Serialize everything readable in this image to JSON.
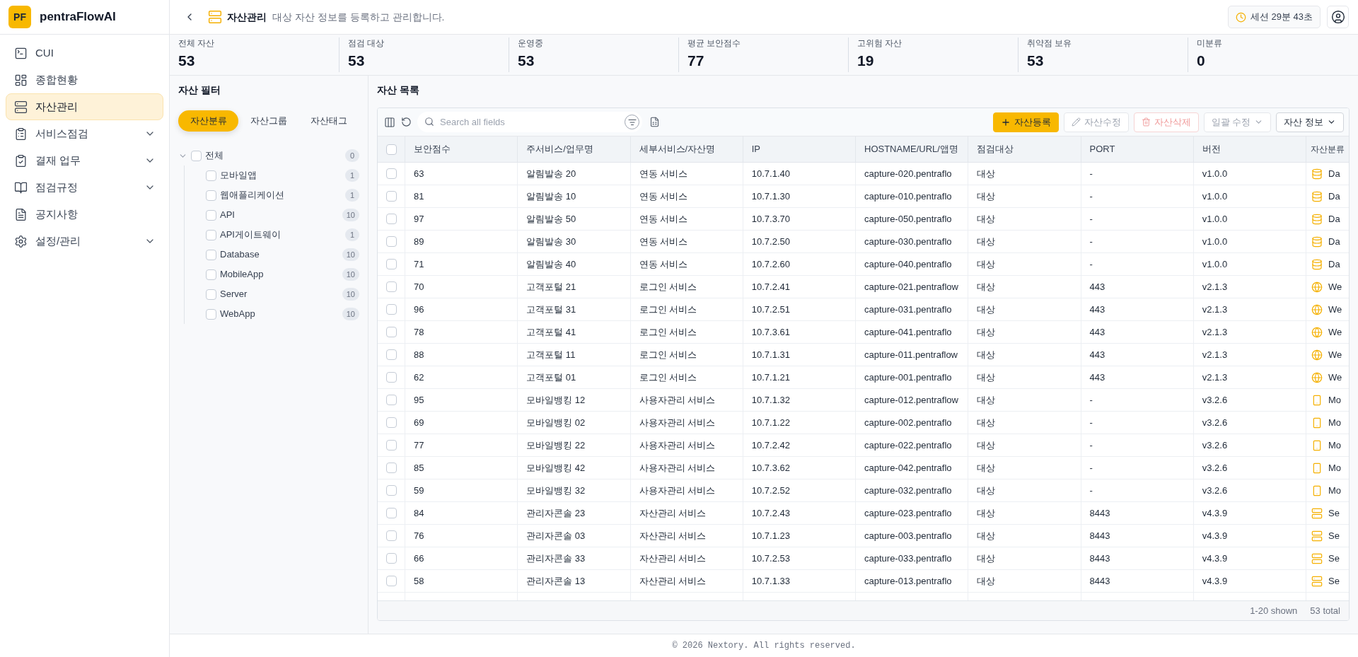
{
  "app": {
    "logo": "PF",
    "name": "pentraFlowAI"
  },
  "sidebar": {
    "items": [
      {
        "label": "CUI",
        "kind": "link",
        "selected": false
      },
      {
        "label": "종합현황",
        "kind": "link",
        "selected": false
      },
      {
        "label": "자산관리",
        "kind": "link",
        "selected": true
      },
      {
        "label": "서비스점검",
        "kind": "group",
        "selected": false,
        "expanded": false
      },
      {
        "label": "결재 업무",
        "kind": "group",
        "selected": false,
        "expanded": false
      },
      {
        "label": "점검규정",
        "kind": "group",
        "selected": false,
        "expanded": false
      },
      {
        "label": "공지사항",
        "kind": "link",
        "selected": false
      },
      {
        "label": "설정/관리",
        "kind": "group",
        "selected": false,
        "expanded": false
      }
    ]
  },
  "header": {
    "title": "자산관리",
    "description": "대상 자산 정보를 등록하고 관리합니다.",
    "session": "세션 29분 43초"
  },
  "stats": [
    {
      "label": "전체 자산",
      "value": "53"
    },
    {
      "label": "점검 대상",
      "value": "53"
    },
    {
      "label": "운영중",
      "value": "53"
    },
    {
      "label": "평균 보안점수",
      "value": "77"
    },
    {
      "label": "고위험 자산",
      "value": "19"
    },
    {
      "label": "취약점 보유",
      "value": "53"
    },
    {
      "label": "미분류",
      "value": "0"
    }
  ],
  "filter": {
    "title": "자산 필터",
    "tabs": [
      {
        "label": "자산분류",
        "selected": true
      },
      {
        "label": "자산그룹",
        "selected": false
      },
      {
        "label": "자산태그",
        "selected": false
      }
    ],
    "tree": [
      {
        "label": "전체",
        "count": "0",
        "checked": false,
        "expanded": true,
        "children": [
          {
            "label": "모바일앱",
            "count": "1",
            "checked": false
          },
          {
            "label": "웹애플리케이션",
            "count": "1",
            "checked": false
          },
          {
            "label": "API",
            "count": "10",
            "checked": false
          },
          {
            "label": "API게이트웨이",
            "count": "1",
            "checked": false
          },
          {
            "label": "Database",
            "count": "10",
            "checked": false
          },
          {
            "label": "MobileApp",
            "count": "10",
            "checked": false
          },
          {
            "label": "Server",
            "count": "10",
            "checked": false
          },
          {
            "label": "WebApp",
            "count": "10",
            "checked": false
          }
        ]
      }
    ]
  },
  "assets": {
    "title": "자산 목록",
    "search": {
      "placeholder": "Search all fields"
    },
    "buttons": [
      {
        "label": "자산등록",
        "kind": "primary",
        "disabled": false
      },
      {
        "label": "자산수정",
        "kind": "edit",
        "disabled": true
      },
      {
        "label": "자산삭제",
        "kind": "delete",
        "disabled": true
      },
      {
        "label": "일괄 수정",
        "kind": "dropdown",
        "disabled": true
      },
      {
        "label": "자산 정보",
        "kind": "dropdown",
        "disabled": false
      }
    ],
    "table": {
      "select_all": {
        "checked": false
      },
      "columns": [
        "보안점수",
        "주서비스/업무명",
        "세부서비스/자산명",
        "IP",
        "HOSTNAME/URL/앱명",
        "점검대상",
        "PORT",
        "버전",
        "자산분류"
      ],
      "rows": [
        {
          "checked": false,
          "cells": [
            "63",
            "알림발송 20",
            "연동 서비스",
            "10.7.1.40",
            "capture-020.pentraflo",
            "대상",
            "-",
            "v1.0.0"
          ],
          "category": {
            "kind": "database",
            "label": "Da"
          }
        },
        {
          "checked": false,
          "cells": [
            "81",
            "알림발송 10",
            "연동 서비스",
            "10.7.1.30",
            "capture-010.pentraflo",
            "대상",
            "-",
            "v1.0.0"
          ],
          "category": {
            "kind": "database",
            "label": "Da"
          }
        },
        {
          "checked": false,
          "cells": [
            "97",
            "알림발송 50",
            "연동 서비스",
            "10.7.3.70",
            "capture-050.pentraflo",
            "대상",
            "-",
            "v1.0.0"
          ],
          "category": {
            "kind": "database",
            "label": "Da"
          }
        },
        {
          "checked": false,
          "cells": [
            "89",
            "알림발송 30",
            "연동 서비스",
            "10.7.2.50",
            "capture-030.pentraflo",
            "대상",
            "-",
            "v1.0.0"
          ],
          "category": {
            "kind": "database",
            "label": "Da"
          }
        },
        {
          "checked": false,
          "cells": [
            "71",
            "알림발송 40",
            "연동 서비스",
            "10.7.2.60",
            "capture-040.pentraflo",
            "대상",
            "-",
            "v1.0.0"
          ],
          "category": {
            "kind": "database",
            "label": "Da"
          }
        },
        {
          "checked": false,
          "cells": [
            "70",
            "고객포털 21",
            "로그인 서비스",
            "10.7.2.41",
            "capture-021.pentraflow",
            "대상",
            "443",
            "v2.1.3"
          ],
          "category": {
            "kind": "web",
            "label": "We"
          }
        },
        {
          "checked": false,
          "cells": [
            "96",
            "고객포털 31",
            "로그인 서비스",
            "10.7.2.51",
            "capture-031.pentraflo",
            "대상",
            "443",
            "v2.1.3"
          ],
          "category": {
            "kind": "web",
            "label": "We"
          }
        },
        {
          "checked": false,
          "cells": [
            "78",
            "고객포털 41",
            "로그인 서비스",
            "10.7.3.61",
            "capture-041.pentraflo",
            "대상",
            "443",
            "v2.1.3"
          ],
          "category": {
            "kind": "web",
            "label": "We"
          }
        },
        {
          "checked": false,
          "cells": [
            "88",
            "고객포털 11",
            "로그인 서비스",
            "10.7.1.31",
            "capture-011.pentraflow",
            "대상",
            "443",
            "v2.1.3"
          ],
          "category": {
            "kind": "web",
            "label": "We"
          }
        },
        {
          "checked": false,
          "cells": [
            "62",
            "고객포털 01",
            "로그인 서비스",
            "10.7.1.21",
            "capture-001.pentraflo",
            "대상",
            "443",
            "v2.1.3"
          ],
          "category": {
            "kind": "web",
            "label": "We"
          }
        },
        {
          "checked": false,
          "cells": [
            "95",
            "모바일뱅킹 12",
            "사용자관리 서비스",
            "10.7.1.32",
            "capture-012.pentraflow",
            "대상",
            "-",
            "v3.2.6"
          ],
          "category": {
            "kind": "mobile",
            "label": "Mo"
          }
        },
        {
          "checked": false,
          "cells": [
            "69",
            "모바일뱅킹 02",
            "사용자관리 서비스",
            "10.7.1.22",
            "capture-002.pentraflo",
            "대상",
            "-",
            "v3.2.6"
          ],
          "category": {
            "kind": "mobile",
            "label": "Mo"
          }
        },
        {
          "checked": false,
          "cells": [
            "77",
            "모바일뱅킹 22",
            "사용자관리 서비스",
            "10.7.2.42",
            "capture-022.pentraflo",
            "대상",
            "-",
            "v3.2.6"
          ],
          "category": {
            "kind": "mobile",
            "label": "Mo"
          }
        },
        {
          "checked": false,
          "cells": [
            "85",
            "모바일뱅킹 42",
            "사용자관리 서비스",
            "10.7.3.62",
            "capture-042.pentraflo",
            "대상",
            "-",
            "v3.2.6"
          ],
          "category": {
            "kind": "mobile",
            "label": "Mo"
          }
        },
        {
          "checked": false,
          "cells": [
            "59",
            "모바일뱅킹 32",
            "사용자관리 서비스",
            "10.7.2.52",
            "capture-032.pentraflo",
            "대상",
            "-",
            "v3.2.6"
          ],
          "category": {
            "kind": "mobile",
            "label": "Mo"
          }
        },
        {
          "checked": false,
          "cells": [
            "84",
            "관리자콘솔 23",
            "자산관리 서비스",
            "10.7.2.43",
            "capture-023.pentraflo",
            "대상",
            "8443",
            "v4.3.9"
          ],
          "category": {
            "kind": "server",
            "label": "Se"
          }
        },
        {
          "checked": false,
          "cells": [
            "76",
            "관리자콘솔 03",
            "자산관리 서비스",
            "10.7.1.23",
            "capture-003.pentraflo",
            "대상",
            "8443",
            "v4.3.9"
          ],
          "category": {
            "kind": "server",
            "label": "Se"
          }
        },
        {
          "checked": false,
          "cells": [
            "66",
            "관리자콘솔 33",
            "자산관리 서비스",
            "10.7.2.53",
            "capture-033.pentraflo",
            "대상",
            "8443",
            "v4.3.9"
          ],
          "category": {
            "kind": "server",
            "label": "Se"
          }
        },
        {
          "checked": false,
          "cells": [
            "58",
            "관리자콘솔 13",
            "자산관리 서비스",
            "10.7.1.33",
            "capture-013.pentraflo",
            "대상",
            "8443",
            "v4.3.9"
          ],
          "category": {
            "kind": "server",
            "label": "Se"
          }
        }
      ]
    },
    "shown": "1-20 shown",
    "total": "53 total"
  },
  "footer": "© 2026 Nextory. All rights reserved."
}
